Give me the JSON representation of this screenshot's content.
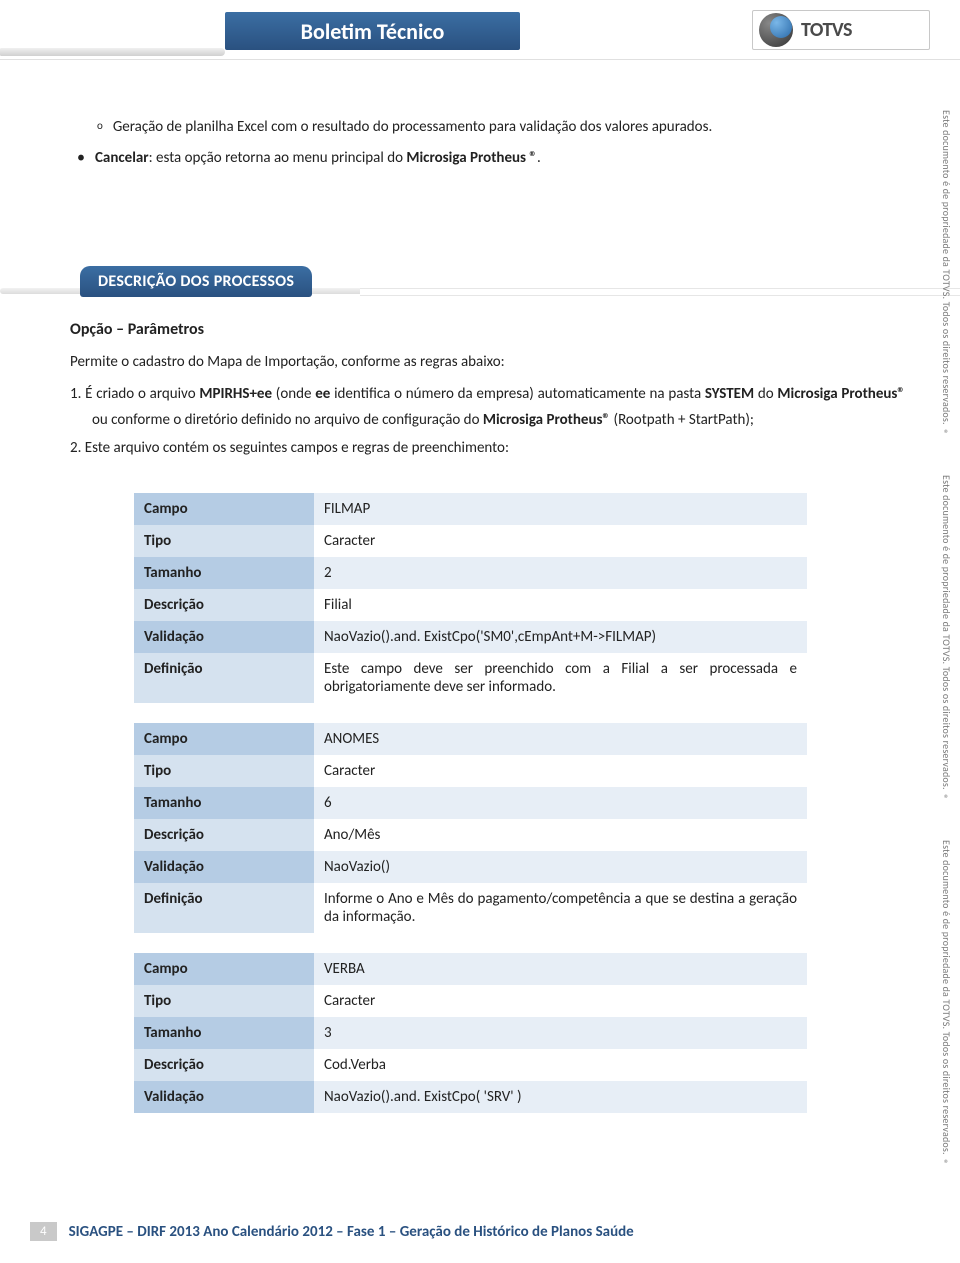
{
  "header": {
    "title": "Boletim Técnico",
    "logo_text": "TOTVS"
  },
  "bullets": {
    "sub": "Geração de planilha Excel com o resultado do processamento para validação dos valores apurados.",
    "main_prefix": "Cancelar",
    "main_rest": ": esta opção retorna ao menu principal do ",
    "main_bold": "Microsiga Protheus ®",
    "main_end": "."
  },
  "section_title": "DESCRIÇÃO DOS PROCESSOS",
  "opcao_title": "Opção – Parâmetros",
  "intro": "Permite o cadastro do Mapa de Importação, conforme as regras abaixo:",
  "num1": {
    "p1": "1.   É criado o arquivo ",
    "b1": "MPIRHS+ee",
    "p2": " (onde ",
    "b2": "ee",
    "p3": " identifica o número da empresa) automaticamente na pasta ",
    "b3": "SYSTEM",
    "p4": " do ",
    "b4": "Microsiga Protheus®",
    "p5": " ou conforme o diretório definido no arquivo de configuração do ",
    "b5": "Microsiga Protheus®",
    "p6": " (Rootpath + StartPath);"
  },
  "num2": "2.   Este arquivo contém os seguintes campos e regras de preenchimento:",
  "labels": {
    "campo": "Campo",
    "tipo": "Tipo",
    "tamanho": "Tamanho",
    "descricao": "Descrição",
    "validacao": "Validação",
    "definicao": "Definição"
  },
  "fields": [
    {
      "campo": "FILMAP",
      "tipo": "Caracter",
      "tamanho": "2",
      "descricao": "Filial",
      "validacao": "NaoVazio().and. ExistCpo('SM0',cEmpAnt+M->FILMAP)",
      "definicao": "Este campo deve ser preenchido com a Filial a ser processada e obrigatoriamente deve ser informado."
    },
    {
      "campo": "ANOMES",
      "tipo": "Caracter",
      "tamanho": "6",
      "descricao": "Ano/Mês",
      "validacao": "NaoVazio()",
      "definicao": "Informe o Ano e Mês do pagamento/competência a que se destina a geração da informação."
    },
    {
      "campo": "VERBA",
      "tipo": "Caracter",
      "tamanho": "3",
      "descricao": "Cod.Verba",
      "validacao": "NaoVazio().and. ExistCpo( 'SRV' )"
    }
  ],
  "sidebar_text": "Este documento é de propriedade da TOTVS. Todos os direitos reservados. ®",
  "footer": {
    "page": "4",
    "text": "SIGAGPE – DIRF 2013 Ano Calendário 2012 – Fase 1 – Geração de Histórico de Planos Saúde"
  }
}
